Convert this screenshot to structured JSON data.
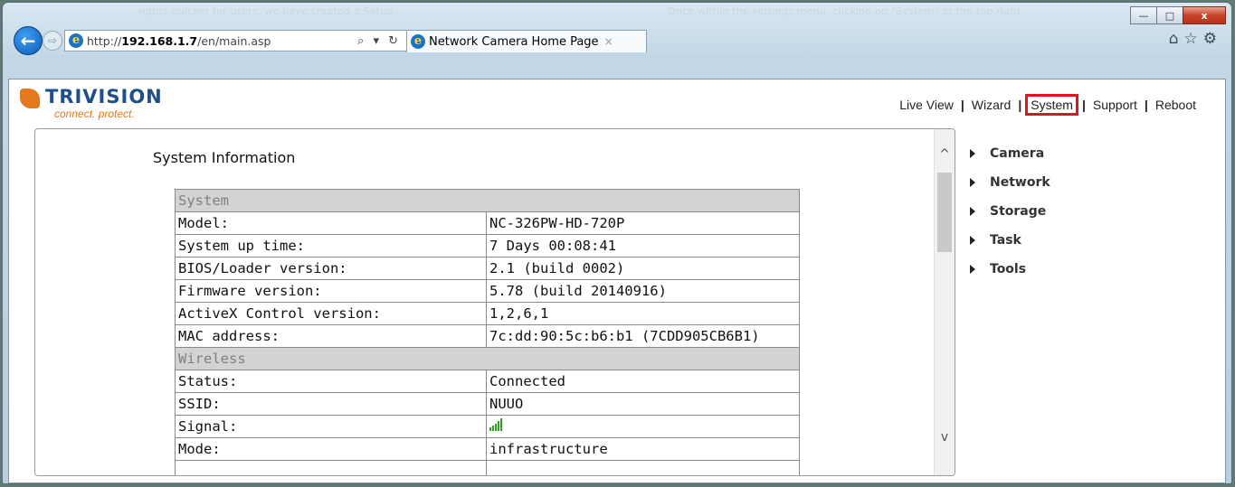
{
  "browser": {
    "url_prefix": "http://",
    "url_host": "192.168.1.7",
    "url_path": "/en/main.asp",
    "tab_title": "Network Camera Home Page",
    "tab_close": "×",
    "search_glyph": "⌕ ▾ ↻",
    "ghost_text_left": "rights quicker for users, we have created a Setup",
    "ghost_text_right": "Once within the settings menu, clicking on \"System\" at the top right",
    "window_controls": {
      "minimize": "—",
      "maximize": "□",
      "close": "x"
    }
  },
  "logo": {
    "name": "TRIVISION",
    "tagline": "connect. protect."
  },
  "topnav": {
    "items": [
      {
        "label": "Live View"
      },
      {
        "label": "Wizard"
      },
      {
        "label": "System",
        "highlighted": true
      },
      {
        "label": "Support"
      },
      {
        "label": "Reboot"
      }
    ],
    "separator": "|",
    "highlight_color": "#e0141e"
  },
  "main": {
    "title": "System Information",
    "sections": [
      {
        "header": "System",
        "rows": [
          {
            "label": "Model:",
            "value": "NC-326PW-HD-720P"
          },
          {
            "label": "System up time:",
            "value": "7 Days 00:08:41"
          },
          {
            "label": "BIOS/Loader version:",
            "value": "2.1 (build 0002)"
          },
          {
            "label": "Firmware version:",
            "value": "5.78 (build 20140916)"
          },
          {
            "label": "ActiveX Control version:",
            "value": "1,2,6,1"
          },
          {
            "label": "MAC address:",
            "value": "7c:dd:90:5c:b6:b1 (7CDD905CB6B1)"
          }
        ]
      },
      {
        "header": "Wireless",
        "rows": [
          {
            "label": "Status:",
            "value": "Connected"
          },
          {
            "label": "SSID:",
            "value": "NUUO"
          },
          {
            "label": "Signal:",
            "value": "",
            "icon": "signal-strength-icon",
            "signal_level": 1.0,
            "signal_color": "#2ea01d"
          },
          {
            "label": "Mode:",
            "value": "infrastructure"
          }
        ]
      }
    ]
  },
  "sidemenu": {
    "items": [
      "Camera",
      "Network",
      "Storage",
      "Task",
      "Tools"
    ]
  },
  "scrollbar": {
    "up_glyph": "^",
    "down_glyph": "v"
  }
}
